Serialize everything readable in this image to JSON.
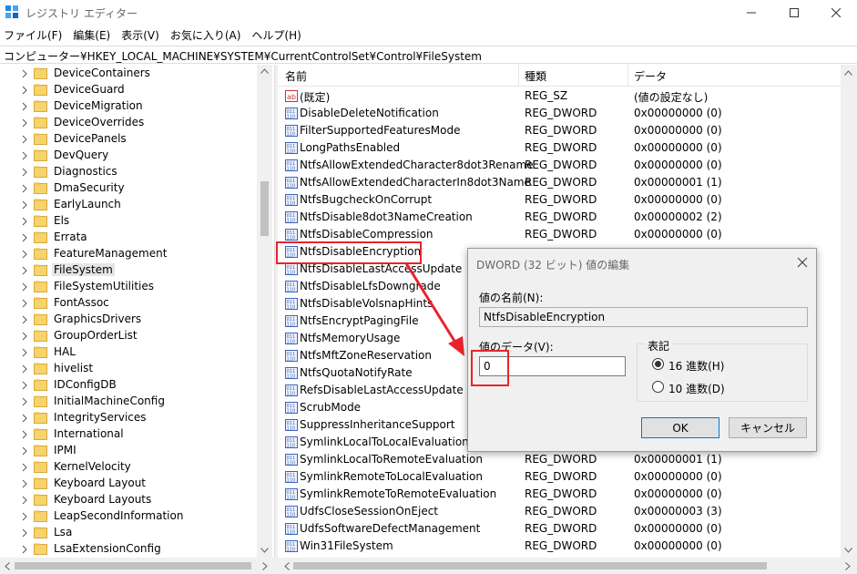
{
  "window": {
    "title": "レジストリ エディター"
  },
  "menu": [
    "ファイル(F)",
    "編集(E)",
    "表示(V)",
    "お気に入り(A)",
    "ヘルプ(H)"
  ],
  "address": "コンピューター¥HKEY_LOCAL_MACHINE¥SYSTEM¥CurrentControlSet¥Control¥FileSystem",
  "tree": [
    {
      "label": "DeviceContainers"
    },
    {
      "label": "DeviceGuard"
    },
    {
      "label": "DeviceMigration"
    },
    {
      "label": "DeviceOverrides"
    },
    {
      "label": "DevicePanels"
    },
    {
      "label": "DevQuery"
    },
    {
      "label": "Diagnostics"
    },
    {
      "label": "DmaSecurity"
    },
    {
      "label": "EarlyLaunch"
    },
    {
      "label": "Els"
    },
    {
      "label": "Errata"
    },
    {
      "label": "FeatureManagement"
    },
    {
      "label": "FileSystem",
      "selected": true
    },
    {
      "label": "FileSystemUtilities"
    },
    {
      "label": "FontAssoc"
    },
    {
      "label": "GraphicsDrivers"
    },
    {
      "label": "GroupOrderList"
    },
    {
      "label": "HAL"
    },
    {
      "label": "hivelist"
    },
    {
      "label": "IDConfigDB"
    },
    {
      "label": "InitialMachineConfig"
    },
    {
      "label": "IntegrityServices"
    },
    {
      "label": "International"
    },
    {
      "label": "IPMI"
    },
    {
      "label": "KernelVelocity"
    },
    {
      "label": "Keyboard Layout"
    },
    {
      "label": "Keyboard Layouts"
    },
    {
      "label": "LeapSecondInformation"
    },
    {
      "label": "Lsa"
    },
    {
      "label": "LsaExtensionConfig"
    }
  ],
  "columns": {
    "name": "名前",
    "type": "種類",
    "data": "データ"
  },
  "values": [
    {
      "name": "(既定)",
      "type": "REG_SZ",
      "data": "(値の設定なし)",
      "icon": "string"
    },
    {
      "name": "DisableDeleteNotification",
      "type": "REG_DWORD",
      "data": "0x00000000 (0)",
      "icon": "binary"
    },
    {
      "name": "FilterSupportedFeaturesMode",
      "type": "REG_DWORD",
      "data": "0x00000000 (0)",
      "icon": "binary"
    },
    {
      "name": "LongPathsEnabled",
      "type": "REG_DWORD",
      "data": "0x00000000 (0)",
      "icon": "binary"
    },
    {
      "name": "NtfsAllowExtendedCharacter8dot3Rename",
      "type": "REG_DWORD",
      "data": "0x00000000 (0)",
      "icon": "binary"
    },
    {
      "name": "NtfsAllowExtendedCharacterIn8dot3Name",
      "type": "REG_DWORD",
      "data": "0x00000001 (1)",
      "icon": "binary"
    },
    {
      "name": "NtfsBugcheckOnCorrupt",
      "type": "REG_DWORD",
      "data": "0x00000000 (0)",
      "icon": "binary"
    },
    {
      "name": "NtfsDisable8dot3NameCreation",
      "type": "REG_DWORD",
      "data": "0x00000002 (2)",
      "icon": "binary"
    },
    {
      "name": "NtfsDisableCompression",
      "type": "REG_DWORD",
      "data": "0x00000000 (0)",
      "icon": "binary"
    },
    {
      "name": "NtfsDisableEncryption",
      "type": "",
      "data": "",
      "icon": "binary"
    },
    {
      "name": "NtfsDisableLastAccessUpdate",
      "type": "",
      "data": "",
      "icon": "binary"
    },
    {
      "name": "NtfsDisableLfsDowngrade",
      "type": "",
      "data": "",
      "icon": "binary"
    },
    {
      "name": "NtfsDisableVolsnapHints",
      "type": "",
      "data": "",
      "icon": "binary"
    },
    {
      "name": "NtfsEncryptPagingFile",
      "type": "",
      "data": "",
      "icon": "binary"
    },
    {
      "name": "NtfsMemoryUsage",
      "type": "",
      "data": "",
      "icon": "binary"
    },
    {
      "name": "NtfsMftZoneReservation",
      "type": "",
      "data": "",
      "icon": "binary"
    },
    {
      "name": "NtfsQuotaNotifyRate",
      "type": "",
      "data": "",
      "icon": "binary"
    },
    {
      "name": "RefsDisableLastAccessUpdate",
      "type": "",
      "data": "",
      "icon": "binary"
    },
    {
      "name": "ScrubMode",
      "type": "",
      "data": "",
      "icon": "binary"
    },
    {
      "name": "SuppressInheritanceSupport",
      "type": "",
      "data": "",
      "icon": "binary"
    },
    {
      "name": "SymlinkLocalToLocalEvaluation",
      "type": "",
      "data": "",
      "icon": "binary"
    },
    {
      "name": "SymlinkLocalToRemoteEvaluation",
      "type": "REG_DWORD",
      "data": "0x00000001 (1)",
      "icon": "binary"
    },
    {
      "name": "SymlinkRemoteToLocalEvaluation",
      "type": "REG_DWORD",
      "data": "0x00000000 (0)",
      "icon": "binary"
    },
    {
      "name": "SymlinkRemoteToRemoteEvaluation",
      "type": "REG_DWORD",
      "data": "0x00000000 (0)",
      "icon": "binary"
    },
    {
      "name": "UdfsCloseSessionOnEject",
      "type": "REG_DWORD",
      "data": "0x00000003 (3)",
      "icon": "binary"
    },
    {
      "name": "UdfsSoftwareDefectManagement",
      "type": "REG_DWORD",
      "data": "0x00000000 (0)",
      "icon": "binary"
    },
    {
      "name": "Win31FileSystem",
      "type": "REG_DWORD",
      "data": "0x00000000 (0)",
      "icon": "binary"
    }
  ],
  "dialog": {
    "title": "DWORD (32 ビット) 値の編集",
    "name_label": "値の名前(N):",
    "name_value": "NtfsDisableEncryption",
    "data_label": "値のデータ(V):",
    "data_value": "0",
    "base_label": "表記",
    "hex_label": "16 進数(H)",
    "dec_label": "10 進数(D)",
    "ok": "OK",
    "cancel": "キャンセル"
  },
  "colors": {
    "annotation": "#e8242b",
    "selection": "#e5e5e5",
    "folder": "#f6d46b"
  }
}
